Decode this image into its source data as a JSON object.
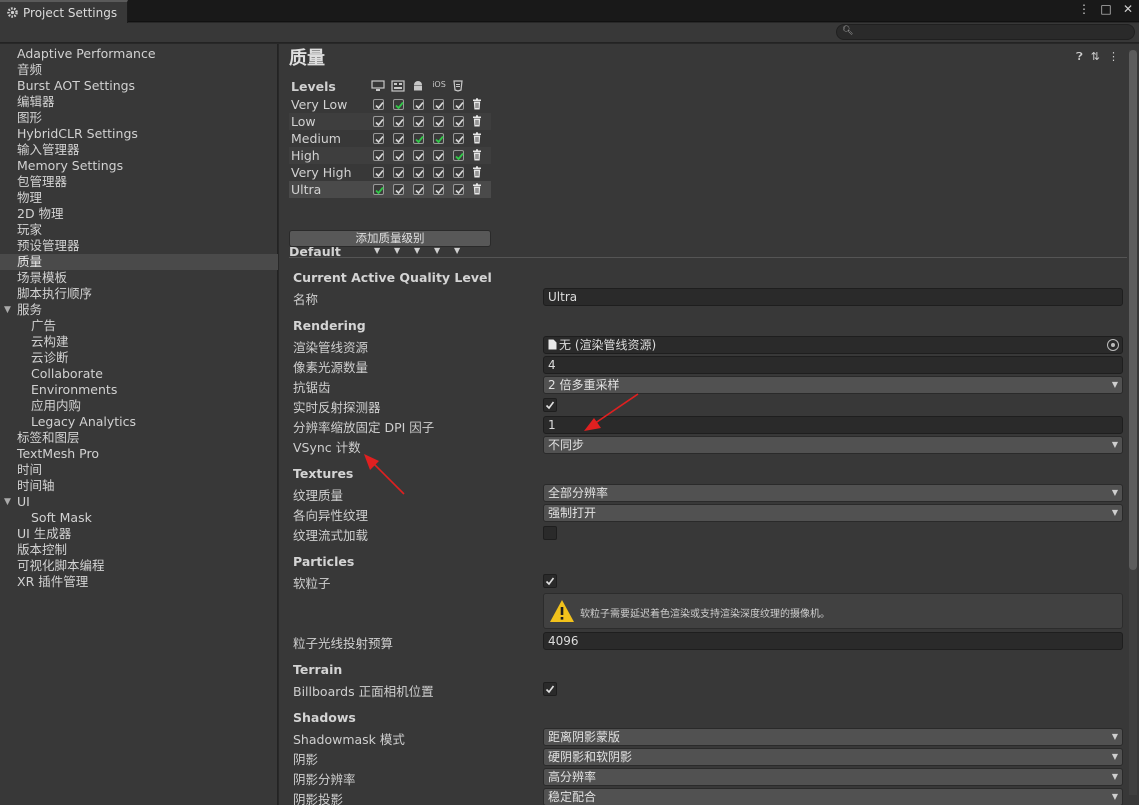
{
  "window": {
    "tab_title": "Project Settings",
    "controls": [
      "⋮",
      "□",
      "✕"
    ]
  },
  "search": {
    "placeholder": ""
  },
  "sidebar": {
    "items": [
      {
        "label": "Adaptive Performance",
        "indent": 0
      },
      {
        "label": "音频",
        "indent": 0
      },
      {
        "label": "Burst AOT Settings",
        "indent": 0
      },
      {
        "label": "编辑器",
        "indent": 0
      },
      {
        "label": "图形",
        "indent": 0
      },
      {
        "label": "HybridCLR Settings",
        "indent": 0
      },
      {
        "label": "输入管理器",
        "indent": 0
      },
      {
        "label": "Memory Settings",
        "indent": 0
      },
      {
        "label": "包管理器",
        "indent": 0
      },
      {
        "label": "物理",
        "indent": 0
      },
      {
        "label": "2D 物理",
        "indent": 0
      },
      {
        "label": "玩家",
        "indent": 0
      },
      {
        "label": "预设管理器",
        "indent": 0
      },
      {
        "label": "质量",
        "indent": 0,
        "selected": true
      },
      {
        "label": "场景模板",
        "indent": 0
      },
      {
        "label": "脚本执行顺序",
        "indent": 0
      },
      {
        "label": "服务",
        "indent": 0,
        "expanded": true
      },
      {
        "label": "广告",
        "indent": 1
      },
      {
        "label": "云构建",
        "indent": 1
      },
      {
        "label": "云诊断",
        "indent": 1
      },
      {
        "label": "Collaborate",
        "indent": 1
      },
      {
        "label": "Environments",
        "indent": 1
      },
      {
        "label": "应用内购",
        "indent": 1
      },
      {
        "label": "Legacy Analytics",
        "indent": 1
      },
      {
        "label": "标签和图层",
        "indent": 0
      },
      {
        "label": "TextMesh Pro",
        "indent": 0
      },
      {
        "label": "时间",
        "indent": 0
      },
      {
        "label": "时间轴",
        "indent": 0
      },
      {
        "label": "UI",
        "indent": 0,
        "expanded": true
      },
      {
        "label": "Soft Mask",
        "indent": 1
      },
      {
        "label": "UI 生成器",
        "indent": 0
      },
      {
        "label": "版本控制",
        "indent": 0
      },
      {
        "label": "可视化脚本编程",
        "indent": 0
      },
      {
        "label": "XR 插件管理",
        "indent": 0
      }
    ]
  },
  "main": {
    "title": "质量",
    "levels": {
      "header": "Levels",
      "platforms": [
        "pc-icon",
        "webgl-icon",
        "android-icon",
        "iOS",
        "html5-icon"
      ],
      "ios_label": "iOS",
      "rows": [
        {
          "name": "Very Low",
          "default_col": 1
        },
        {
          "name": "Low",
          "default_col": -1
        },
        {
          "name": "Medium",
          "default_col": 2,
          "extra_col": 3
        },
        {
          "name": "High",
          "default_col": 4
        },
        {
          "name": "Very High",
          "default_col": -1
        },
        {
          "name": "Ultra",
          "default_col": 0,
          "selected": true
        }
      ],
      "default_label": "Default",
      "add_button": "添加质量级别"
    },
    "current": {
      "section": "Current Active Quality Level",
      "name_label": "名称",
      "name_value": "Ultra"
    },
    "rendering": {
      "section": "Rendering",
      "pipeline_label": "渲染管线资源",
      "pipeline_value": "无 (渲染管线资源)",
      "pixel_lights_label": "像素光源数量",
      "pixel_lights_value": "4",
      "aa_label": "抗锯齿",
      "aa_value": "2 倍多重采样",
      "realtime_probes_label": "实时反射探测器",
      "realtime_probes_checked": true,
      "dpi_label": "分辨率缩放固定 DPI 因子",
      "dpi_value": "1",
      "vsync_label": "VSync 计数",
      "vsync_value": "不同步"
    },
    "textures": {
      "section": "Textures",
      "quality_label": "纹理质量",
      "quality_value": "全部分辨率",
      "aniso_label": "各向异性纹理",
      "aniso_value": "强制打开",
      "streaming_label": "纹理流式加载",
      "streaming_checked": false
    },
    "particles": {
      "section": "Particles",
      "soft_label": "软粒子",
      "soft_checked": true,
      "warning": "软粒子需要延迟着色渲染或支持渲染深度纹理的摄像机。",
      "raycast_label": "粒子光线投射预算",
      "raycast_value": "4096"
    },
    "terrain": {
      "section": "Terrain",
      "billboards_label": "Billboards 正面相机位置",
      "billboards_checked": true
    },
    "shadows": {
      "section": "Shadows",
      "shadowmask_label": "Shadowmask 模式",
      "shadowmask_value": "距离阴影蒙版",
      "shadows_label": "阴影",
      "shadows_value": "硬阴影和软阴影",
      "resolution_label": "阴影分辨率",
      "resolution_value": "高分辨率",
      "projection_label": "阴影投影",
      "projection_value": "稳定配合"
    }
  },
  "colors": {
    "accent_check": "#33c94a",
    "annotation_red": "#e02020",
    "panel_bg": "#383838",
    "field_bg": "#2a2a2a"
  }
}
